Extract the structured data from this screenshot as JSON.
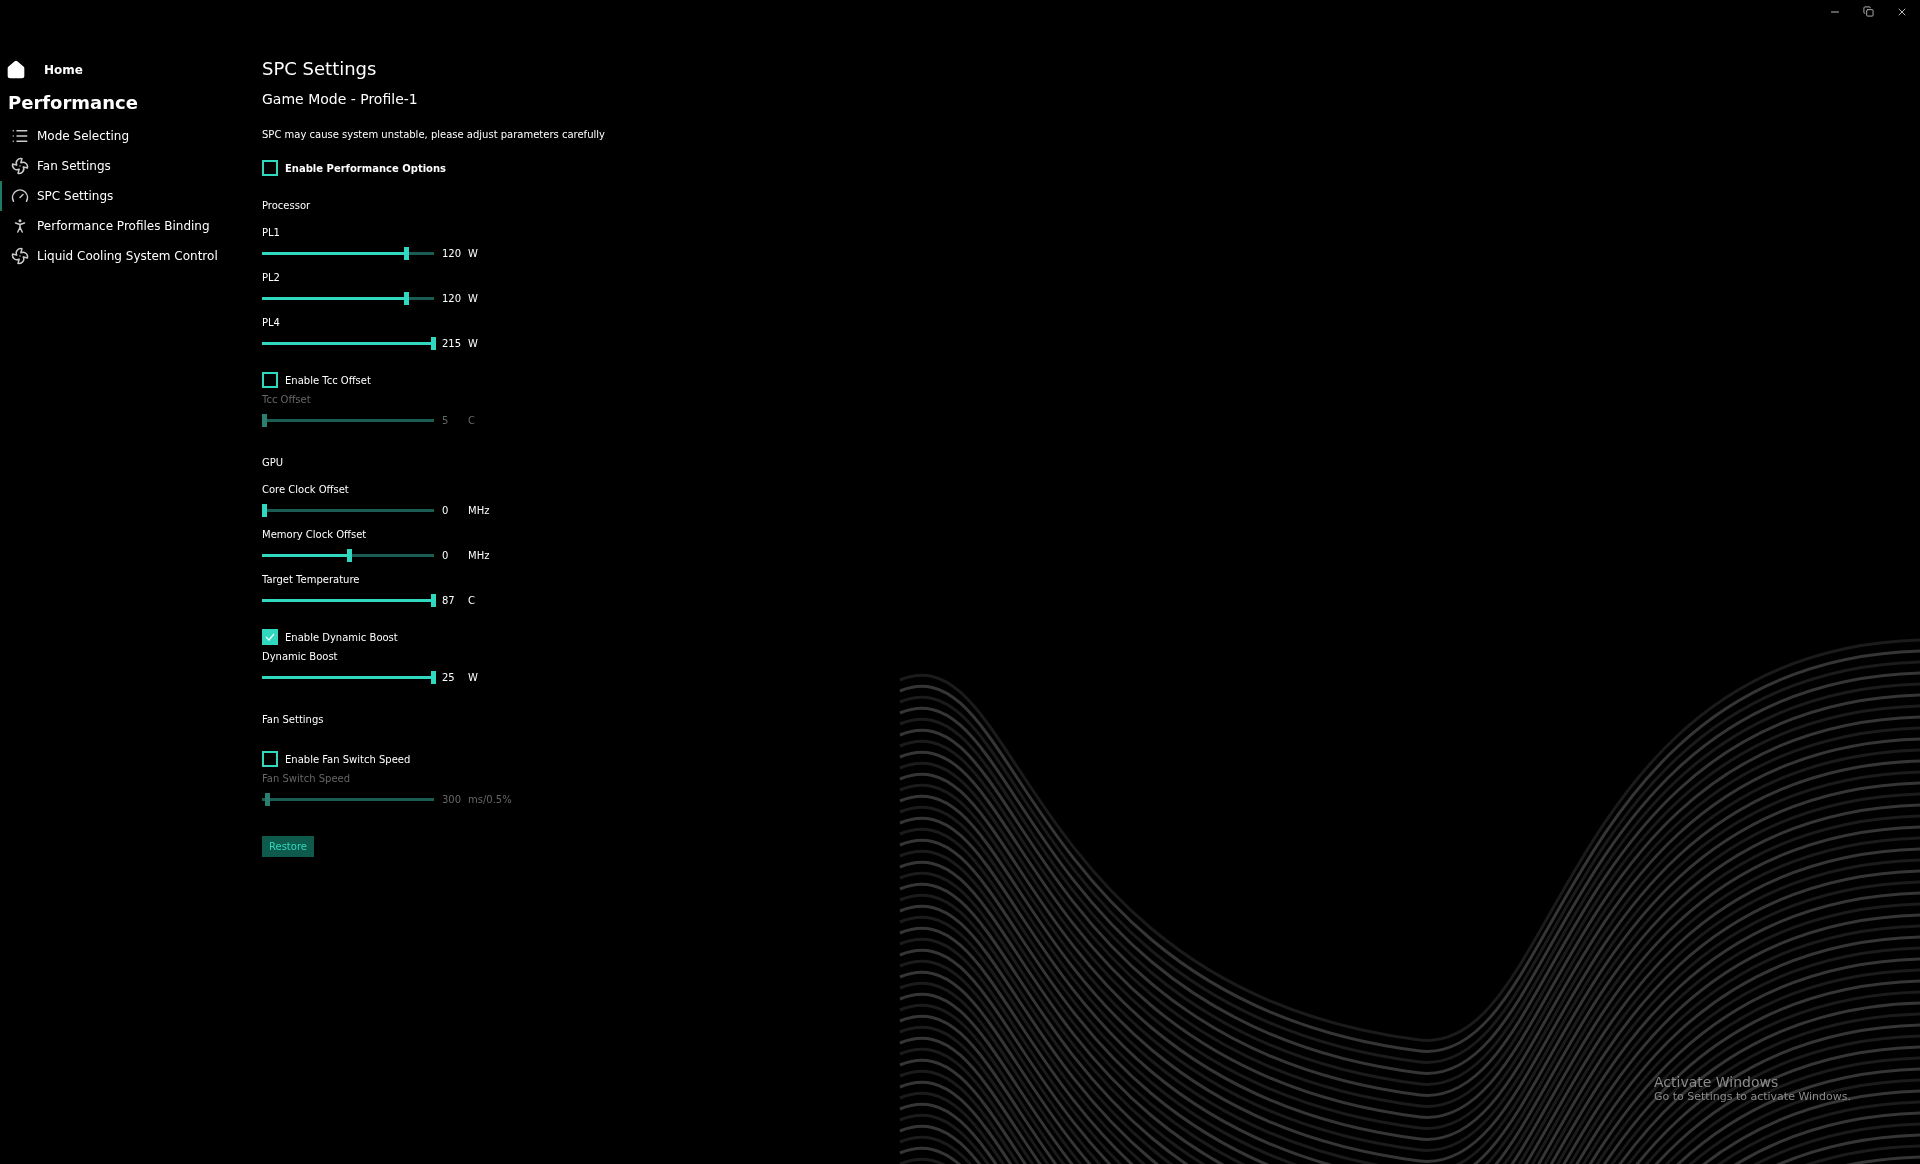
{
  "sidebar": {
    "home": "Home",
    "section": "Performance",
    "items": [
      {
        "label": "Mode Selecting",
        "kind": "list",
        "selected": false
      },
      {
        "label": "Fan Settings",
        "kind": "fan",
        "selected": false
      },
      {
        "label": "SPC Settings",
        "kind": "gauge",
        "selected": true
      },
      {
        "label": "Performance Profiles Binding",
        "kind": "person",
        "selected": false
      },
      {
        "label": "Liquid Cooling System Control",
        "kind": "fan",
        "selected": false
      }
    ]
  },
  "main": {
    "title": "SPC Settings",
    "subtitle": "Game Mode - Profile-1",
    "warning": "SPC may cause system unstable, please adjust parameters carefully",
    "rows": [
      {
        "kind": "checkbox",
        "label": "Enable Performance Options",
        "checked": false,
        "bold": true
      },
      {
        "kind": "heading",
        "label": "Processor"
      },
      {
        "kind": "slider",
        "label": "PL1",
        "level": 0.84,
        "value": "120",
        "unit": "W",
        "disabled": false
      },
      {
        "kind": "slider",
        "label": "PL2",
        "level": 0.84,
        "value": "120",
        "unit": "W",
        "disabled": false
      },
      {
        "kind": "slider",
        "label": "PL4",
        "level": 1,
        "value": "215",
        "unit": "W",
        "disabled": false
      },
      {
        "kind": "checkbox",
        "label": "Enable Tcc Offset",
        "checked": false,
        "bold": false
      },
      {
        "kind": "slider",
        "label": "Tcc Offset",
        "level": 0,
        "value": "5",
        "unit": "C",
        "disabled": true
      },
      {
        "kind": "heading",
        "label": "GPU"
      },
      {
        "kind": "slider",
        "label": "Core Clock Offset",
        "level": 0,
        "value": "0",
        "unit": "MHz",
        "disabled": false
      },
      {
        "kind": "slider",
        "label": "Memory Clock Offset",
        "level": 0.5,
        "value": "0",
        "unit": "MHz",
        "disabled": false
      },
      {
        "kind": "slider",
        "label": "Target Temperature",
        "level": 1,
        "value": "87",
        "unit": "C",
        "disabled": false
      },
      {
        "kind": "checkbox",
        "label": "Enable Dynamic Boost",
        "checked": true,
        "bold": false
      },
      {
        "kind": "slider",
        "label": "Dynamic Boost",
        "level": 1,
        "value": "25",
        "unit": "W",
        "disabled": false
      },
      {
        "kind": "heading",
        "label": "Fan Settings"
      },
      {
        "kind": "checkbox",
        "label": "Enable Fan Switch Speed",
        "checked": false,
        "bold": false
      },
      {
        "kind": "slider",
        "label": "Fan Switch Speed",
        "level": 0.02,
        "value": "300",
        "unit": "ms/0.5%",
        "disabled": true
      }
    ],
    "restore_button": "Restore"
  },
  "os_notice": {
    "title": "Activate Windows",
    "text": "Go to Settings to activate Windows."
  }
}
